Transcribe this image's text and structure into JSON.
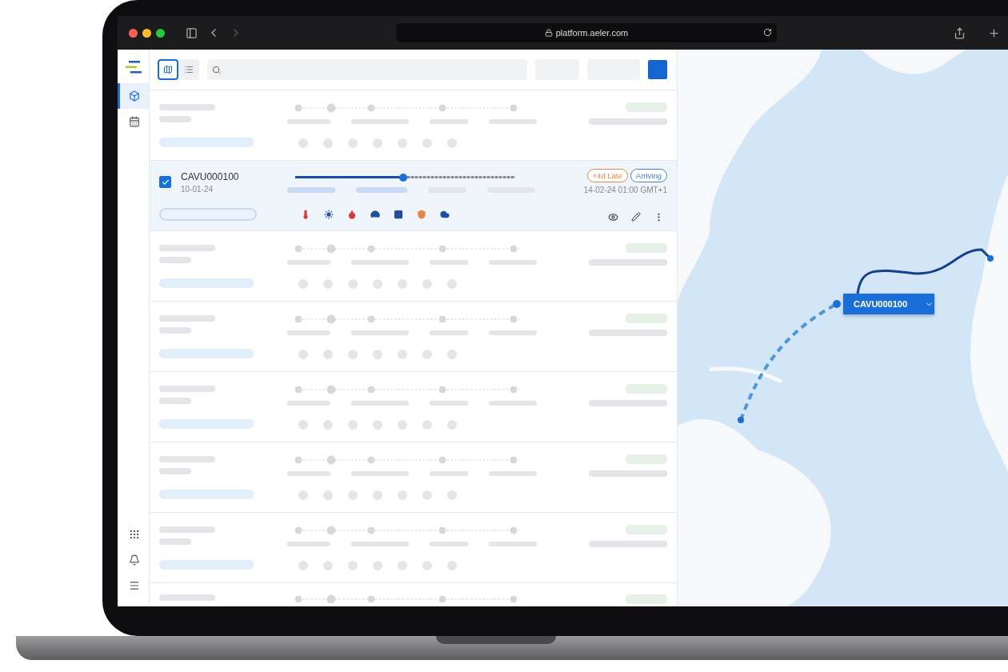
{
  "browser": {
    "url": "platform.aeler.com"
  },
  "sidebar": {
    "items": [
      {
        "kind": "shipments",
        "selected": true
      },
      {
        "kind": "calendar",
        "selected": false
      }
    ],
    "bottom": [
      {
        "kind": "apps"
      },
      {
        "kind": "notifications"
      },
      {
        "kind": "menu"
      }
    ]
  },
  "toolbar": {
    "views": [
      {
        "kind": "map",
        "selected": true
      },
      {
        "kind": "list",
        "selected": false
      }
    ]
  },
  "rows": [
    {
      "kind": "placeholder"
    },
    {
      "kind": "shipment",
      "checked": true,
      "id": "CAVU000100",
      "date": "10-01-24",
      "level": 0.49,
      "badges": [
        {
          "label": "+4d Late",
          "color": "#e8843c"
        },
        {
          "label": "Arriving",
          "color": "#3b7fd0"
        }
      ],
      "eta": "14-02-24 01:00 GMT+1",
      "sensors": [
        {
          "kind": "temperature",
          "color": "#d63a3a"
        },
        {
          "kind": "light",
          "color": "#1f4fa0"
        },
        {
          "kind": "humidity",
          "color": "#d63a3a"
        },
        {
          "kind": "speed",
          "color": "#1f4fa0"
        },
        {
          "kind": "door",
          "color": "#1f4fa0"
        },
        {
          "kind": "security",
          "color": "#e8843c"
        },
        {
          "kind": "co2",
          "color": "#1f4fa0"
        }
      ]
    },
    {
      "kind": "placeholder"
    },
    {
      "kind": "placeholder"
    },
    {
      "kind": "placeholder"
    },
    {
      "kind": "placeholder"
    },
    {
      "kind": "placeholder"
    },
    {
      "kind": "placeholder_cut"
    }
  ],
  "map": {
    "label": "CAVU000100"
  }
}
